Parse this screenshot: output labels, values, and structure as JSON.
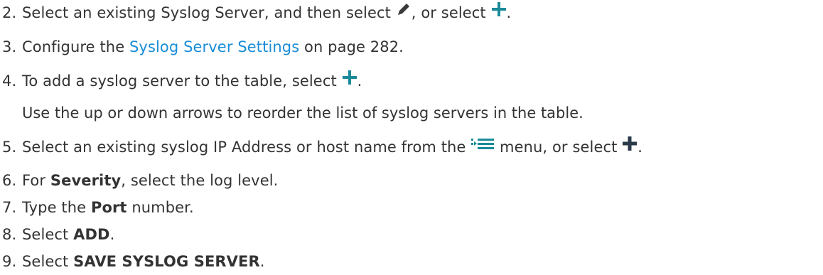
{
  "steps": [
    {
      "number": "2.",
      "parts": [
        "Select an existing Syslog Server, and then select ",
        ", or select ",
        "."
      ]
    },
    {
      "number": "3.",
      "prefix": "Configure the ",
      "link": "Syslog Server Settings",
      "suffix": " on page 282."
    },
    {
      "number": "4.",
      "prefix": "To add a syslog server to the table, select ",
      "suffix": ".",
      "note": "Use the up or down arrows to reorder the list of syslog servers in the table."
    },
    {
      "number": "5.",
      "parts": [
        "Select an existing syslog IP Address or host name from the ",
        " menu, or select ",
        "."
      ]
    },
    {
      "number": "6.",
      "prefix": "For ",
      "bold": "Severity",
      "suffix": ", select the log level."
    },
    {
      "number": "7.",
      "prefix": "Type the ",
      "bold": "Port",
      "suffix": " number."
    },
    {
      "number": "8.",
      "prefix": "Select ",
      "bold": "ADD",
      "suffix": "."
    },
    {
      "number": "9.",
      "prefix": "Select ",
      "bold": "SAVE SYSLOG SERVER",
      "suffix": "."
    }
  ],
  "icons": {
    "edit": "pencil-icon",
    "add": "plus-icon",
    "menu": "list-menu-icon"
  },
  "colors": {
    "text": "#333333",
    "link": "#1a8dd8",
    "plus_teal": "#1a8a99",
    "plus_dark": "#2a3a4a",
    "pencil": "#3a3a3a",
    "menu": "#1a8a99"
  }
}
